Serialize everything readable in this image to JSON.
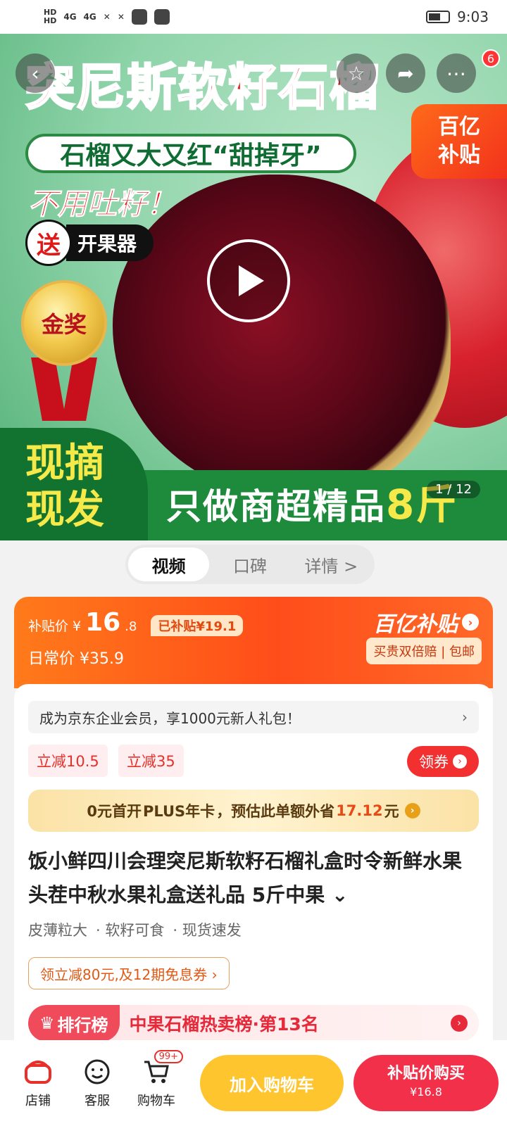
{
  "status_bar": {
    "time": "9:03",
    "network": "4G"
  },
  "hero": {
    "title": "突尼斯软籽石榴",
    "subtitle": "石榴又大又红“甜掉牙”",
    "no_seed": "不用吐籽！",
    "gift_circle": "送",
    "gift_text": "开果器",
    "medal": "金奖",
    "badge_line1": "百亿",
    "badge_line2": "补贴",
    "fresh_line1": "现摘",
    "fresh_line2": "现发",
    "slogan": "只做商超精品",
    "slogan_weight": "8斤",
    "counter": "1 / 12",
    "notification_count": "6"
  },
  "tabs": [
    {
      "label": "视频"
    },
    {
      "label": "口碑"
    },
    {
      "label": "详情 >"
    }
  ],
  "price": {
    "subsidy_label": "补贴价",
    "currency": "¥",
    "subsidy_int": "16",
    "subsidy_dec": ".8",
    "subsidy_tag": "已补贴¥19.1",
    "daily_label": "日常价",
    "daily_price": "¥35.9",
    "brand": "百亿补贴",
    "guarantee": "买贵双倍赔 | 包邮"
  },
  "member_bar": {
    "text": "成为京东企业会员，享1000元新人礼包！",
    "chevron": "›"
  },
  "coupons": [
    {
      "label": "立减10.5"
    },
    {
      "label": "立减35"
    }
  ],
  "claim_button": "领券",
  "plus_bar": {
    "pre": "0元首开",
    "plus": "PLUS年卡",
    "mid": "，预估此单额外省",
    "amount": "17.12",
    "unit": "元"
  },
  "product_title": "饭小鲜四川会理突尼斯软籽石榴礼盒时令新鲜水果头茬中秋水果礼盒送礼品 5斤中果 ⌄",
  "features": [
    "皮薄粒大",
    "· 软籽可食",
    "· 现货速发"
  ],
  "promo": "领立减80元,及12期免息券 ›",
  "rank": {
    "tag": "排行榜",
    "text": "中果石榴热卖榜·第13名"
  },
  "bottom_nav": [
    {
      "label": "店铺"
    },
    {
      "label": "客服"
    },
    {
      "label": "购物车",
      "badge": "99+"
    }
  ],
  "add_cart_label": "加入购物车",
  "buy_label": "补贴价购买",
  "buy_price": "¥16.8",
  "colors": {
    "accent": "#ff4d1a",
    "buy": "#f2304a",
    "cart": "#ffc52e"
  }
}
